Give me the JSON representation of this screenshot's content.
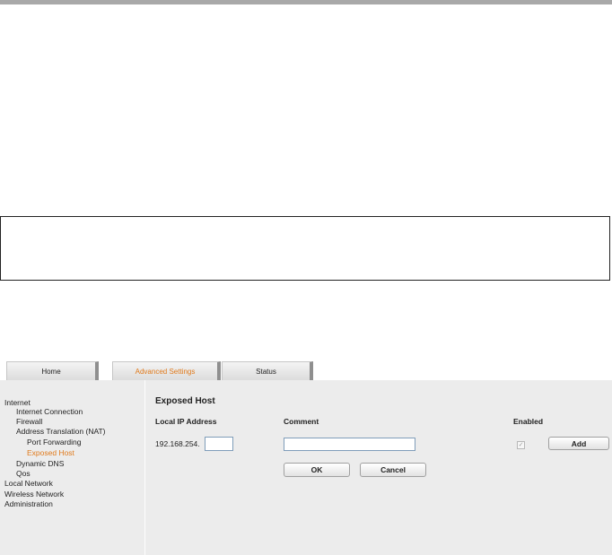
{
  "tabs": [
    {
      "label": "Home"
    },
    {
      "label": "Advanced Settings"
    },
    {
      "label": "Status"
    }
  ],
  "sidebar": {
    "items": [
      {
        "label": "Internet"
      },
      {
        "label": "Internet Connection"
      },
      {
        "label": "Firewall"
      },
      {
        "label": "Address Translation (NAT)"
      },
      {
        "label": "Port Forwarding"
      },
      {
        "label": "Exposed Host"
      },
      {
        "label": "Dynamic DNS"
      },
      {
        "label": "Qos"
      },
      {
        "label": "Local Network"
      },
      {
        "label": "Wireless Network"
      },
      {
        "label": "Administration"
      }
    ]
  },
  "form": {
    "title": "Exposed Host",
    "col_ip": "Local IP Address",
    "col_comment": "Comment",
    "col_enabled": "Enabled",
    "ip_prefix": "192.168.254.",
    "ip_value": "",
    "comment_value": "",
    "enabled_checked": true,
    "add_label": "Add",
    "ok_label": "OK",
    "cancel_label": "Cancel"
  },
  "colors": {
    "accent": "#e07a1c",
    "panel_bg": "#ececec",
    "top_bar": "#a9a9a9"
  }
}
